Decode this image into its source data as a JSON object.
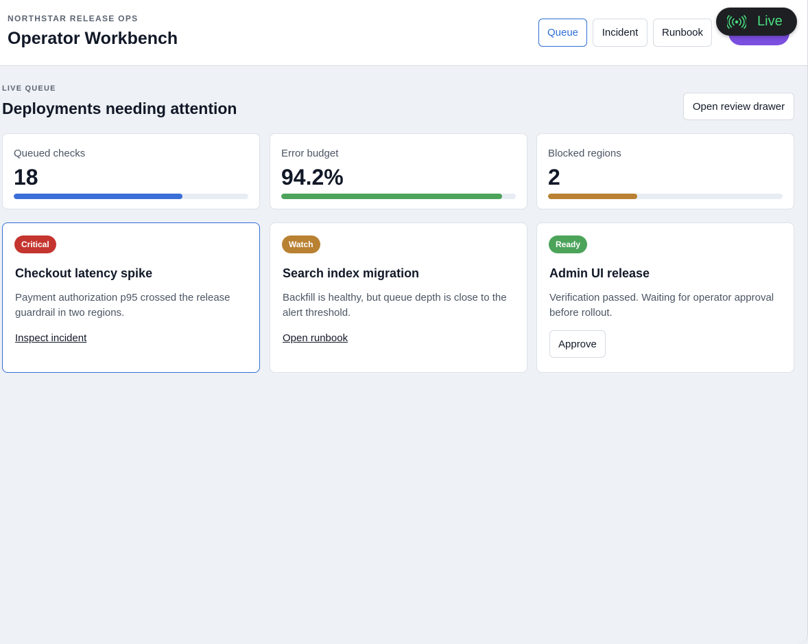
{
  "header": {
    "eyebrow": "NORTHSTAR RELEASE OPS",
    "title": "Operator Workbench",
    "nav": [
      {
        "label": "Queue",
        "active": true
      },
      {
        "label": "Incident",
        "active": false
      },
      {
        "label": "Runbook",
        "active": false
      }
    ],
    "live_indicator": {
      "label": "Live",
      "icon": "broadcast-icon",
      "color": "#4ade80"
    }
  },
  "section": {
    "eyebrow": "LIVE QUEUE",
    "title": "Deployments needing attention",
    "drawer_button": "Open review drawer"
  },
  "metrics": [
    {
      "label": "Queued checks",
      "value": "18",
      "progress": 0.72,
      "color": "#3b6fd8"
    },
    {
      "label": "Error budget",
      "value": "94.2%",
      "progress": 0.942,
      "color": "#4ca35a"
    },
    {
      "label": "Blocked regions",
      "value": "2",
      "progress": 0.38,
      "color": "#b98132"
    }
  ],
  "cards": [
    {
      "badge": "Critical",
      "badge_color": "#c5352f",
      "title": "Checkout latency spike",
      "description": "Payment authorization p95 crossed the release guardrail in two regions.",
      "action": "Inspect incident",
      "action_type": "link",
      "selected": true
    },
    {
      "badge": "Watch",
      "badge_color": "#b98132",
      "title": "Search index migration",
      "description": "Backfill is healthy, but queue depth is close to the alert threshold.",
      "action": "Open runbook",
      "action_type": "link",
      "selected": false
    },
    {
      "badge": "Ready",
      "badge_color": "#4ca35a",
      "title": "Admin UI release",
      "description": "Verification passed. Waiting for operator approval before rollout.",
      "action": "Approve",
      "action_type": "button",
      "selected": false
    }
  ]
}
